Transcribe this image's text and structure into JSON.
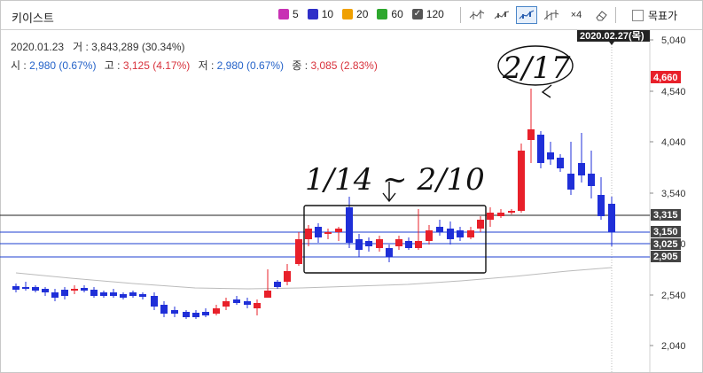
{
  "header": {
    "stock_name": "키이스트",
    "ma_legend": [
      {
        "label": "5",
        "color": "#c832b4"
      },
      {
        "label": "10",
        "color": "#2f2fc8"
      },
      {
        "label": "20",
        "color": "#f0a000"
      },
      {
        "label": "60",
        "color": "#2ea82e"
      },
      {
        "label": "120",
        "color": "#555555",
        "checked": true
      }
    ],
    "tools": [
      {
        "name": "candle-tool-1",
        "label": "",
        "active": false
      },
      {
        "name": "candle-tool-2",
        "label": "",
        "active": false
      },
      {
        "name": "candle-tool-3",
        "label": "",
        "active": true
      },
      {
        "name": "candle-tool-4",
        "label": "",
        "active": false
      },
      {
        "name": "zoom-tool",
        "label": "×4",
        "active": false
      },
      {
        "name": "eraser-tool",
        "label": "",
        "active": false
      }
    ],
    "target_price_label": "목표가"
  },
  "info": {
    "date": "2020.01.23",
    "volume_label": "거",
    "volume_value": "3,843,289 (30.34%)",
    "open_label": "시",
    "open_value": "2,980 (0.67%)",
    "high_label": "고",
    "high_value": "3,125 (4.17%)",
    "low_label": "저",
    "low_value": "2,980 (0.67%)",
    "close_label": "종",
    "close_value": "3,085 (2.83%)"
  },
  "crosshair_date": "2020.02.27(목)",
  "price_axis": {
    "ticks": [
      "5,040",
      "4,540",
      "4,040",
      "3,540",
      "3,040",
      "2,540",
      "2,040"
    ],
    "current_price": "4,660",
    "level_labels": [
      "3,315",
      "3,150",
      "3,025",
      "2,905"
    ]
  },
  "annotations": {
    "range_text": "1/14 ~ 2/10",
    "peak_text": "2/17"
  },
  "colors": {
    "up": "#e8202a",
    "down": "#1f2fd8",
    "hline_black": "#222222",
    "hline_blue": "#1c3fd0",
    "ma120": "#bbbbbb",
    "badge_dark": "#444444",
    "badge_red": "#e8202a"
  }
}
